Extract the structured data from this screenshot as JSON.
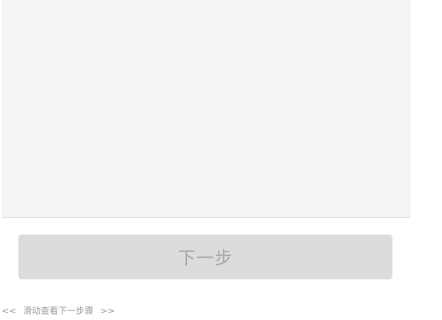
{
  "content": {
    "panel_color": "#f4f4f5"
  },
  "next_button": {
    "label": "下一步",
    "state": "disabled",
    "bg_color": "#dcdcde",
    "text_color": "#a6a6a6"
  },
  "swipe_hint": {
    "left_arrows": "<<",
    "text": "滑动查看下一步骤",
    "right_arrows": ">>"
  }
}
